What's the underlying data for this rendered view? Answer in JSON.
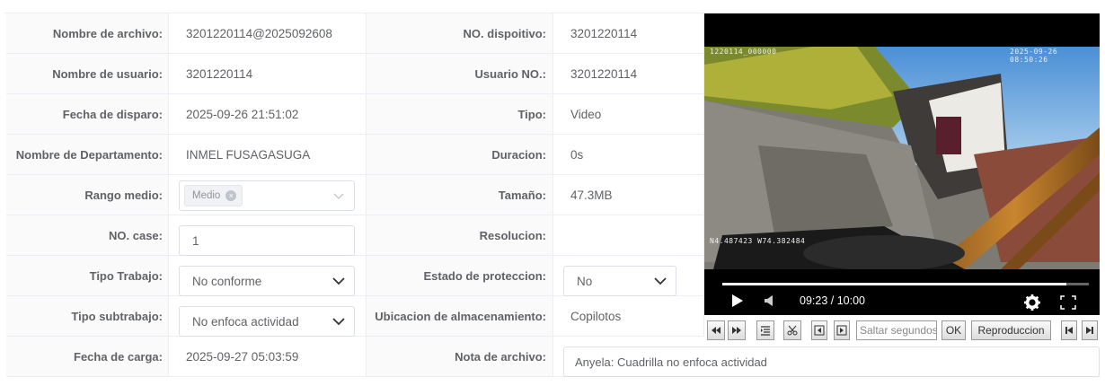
{
  "form": {
    "rows": [
      {
        "label1": "Nombre de archivo:",
        "value1": "3201220114@2025092608",
        "label2": "NO. dispoitivo:",
        "value2": "3201220114"
      },
      {
        "label1": "Nombre de usuario:",
        "value1": "3201220114",
        "label2": "Usuario NO.:",
        "value2": "3201220114"
      },
      {
        "label1": "Fecha de disparo:",
        "value1": "2025-09-26 21:51:02",
        "label2": "Tipo:",
        "value2": "Video"
      },
      {
        "label1": "Nombre de Departamento:",
        "value1": "INMEL FUSAGASUGA",
        "label2": "Duracion:",
        "value2": "0s"
      },
      {
        "label1": "Rango medio:",
        "value1": "Medio",
        "label2": "Tamaño:",
        "value2": "47.3MB"
      },
      {
        "label1": "NO. case:",
        "value1": "1",
        "label2": "Resolucion:",
        "value2": ""
      },
      {
        "label1": "Tipo Trabajo:",
        "value1": "No conforme",
        "label2": "Estado de proteccion:",
        "value2": "No"
      },
      {
        "label1": "Tipo subtrabajo:",
        "value1": "No enfoca actividad",
        "label2": "Ubicacion de almacenamiento:",
        "value2": "Copilotos"
      },
      {
        "label1": "Fecha de carga:",
        "value1": "2025-09-27 05:03:59",
        "label2": "Nota de archivo:",
        "value2": "Anyela: Cuadrilla no enfoca actividad"
      }
    ]
  },
  "player": {
    "osd_top_left": "1220114_000000",
    "osd_top_right": "2025-09-26 08:50:26",
    "osd_coords": "N4.487423 W74.382484",
    "time": "09:23 / 10:00",
    "progress": 0.938,
    "icons": [
      "play-icon",
      "volume-icon",
      "settings-icon",
      "fullscreen-icon"
    ]
  },
  "toolbar": {
    "seek_placeholder": "Saltar segundos",
    "ok_label": "OK",
    "playback_label": "Reproduccion",
    "icons": [
      "rewind-icon",
      "fast-forward-icon",
      "list-icon",
      "cut-icon",
      "prev-frame-icon",
      "next-frame-icon",
      "skip-start-icon",
      "skip-end-icon"
    ]
  }
}
